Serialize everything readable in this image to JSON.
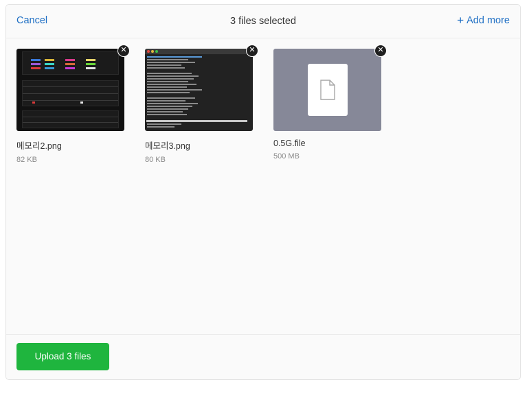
{
  "header": {
    "cancel_label": "Cancel",
    "title": "3 files selected",
    "add_more_label": "Add more",
    "add_more_icon": "plus-icon"
  },
  "files": [
    {
      "name": "메모리2.png",
      "size": "82 KB",
      "thumbnail": "image-preview"
    },
    {
      "name": "메모리3.png",
      "size": "80 KB",
      "thumbnail": "image-preview"
    },
    {
      "name": "0.5G.file",
      "size": "500 MB",
      "thumbnail": "generic-file-icon"
    }
  ],
  "footer": {
    "upload_label": "Upload 3 files"
  },
  "colors": {
    "accent_link": "#1f6fc4",
    "upload_button": "#1fb53e",
    "file_placeholder_bg": "#868898"
  }
}
